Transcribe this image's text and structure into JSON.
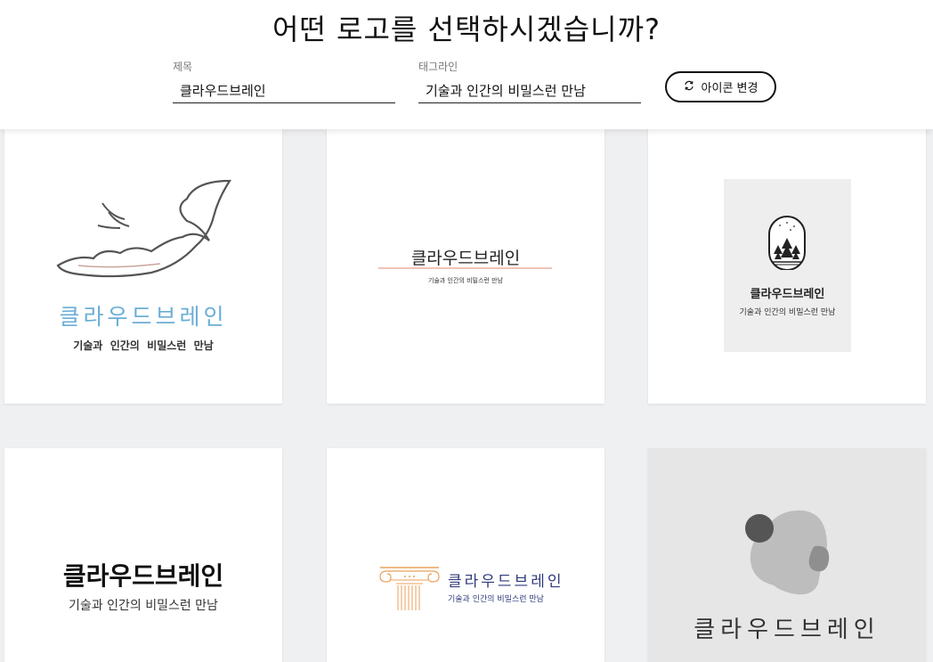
{
  "header": {
    "title": "어떤 로고를 선택하시겠습니까?",
    "title_field": {
      "label": "제목",
      "value": "클라우드브레인"
    },
    "tagline_field": {
      "label": "태그라인",
      "value": "기술과 인간의 비밀스런 만남"
    },
    "change_icon_button": {
      "label": "아이콘 변경",
      "icon": "refresh-icon"
    }
  },
  "logos": [
    {
      "name": "클라우드브레인",
      "tagline": "기술과  인간의  비밀스런  만남",
      "icon": "bird-icon",
      "color": "#6aaed6"
    },
    {
      "name": "클라우드브레인",
      "tagline": "기술과 인간의 비밀스런 만남",
      "icon": "underline-accent",
      "color": "#f2b8a8"
    },
    {
      "name": "클라우드브레인",
      "tagline": "기술과 인간의 비밀스런 만남",
      "icon": "forest-badge-icon",
      "color": "#eeeeee"
    },
    {
      "name": "클라우드브레인",
      "tagline": "기술과 인간의 비밀스런 만남",
      "icon": "none",
      "color": "#111111"
    },
    {
      "name": "클라우드브레인",
      "tagline": "기술과 인간의 비밀스런 만남",
      "icon": "column-capital-icon",
      "color": "#e8a25a"
    },
    {
      "name": "클라우드브레인",
      "tagline": "",
      "icon": "head-silhouette-icon",
      "color": "#bdbdbd"
    }
  ]
}
